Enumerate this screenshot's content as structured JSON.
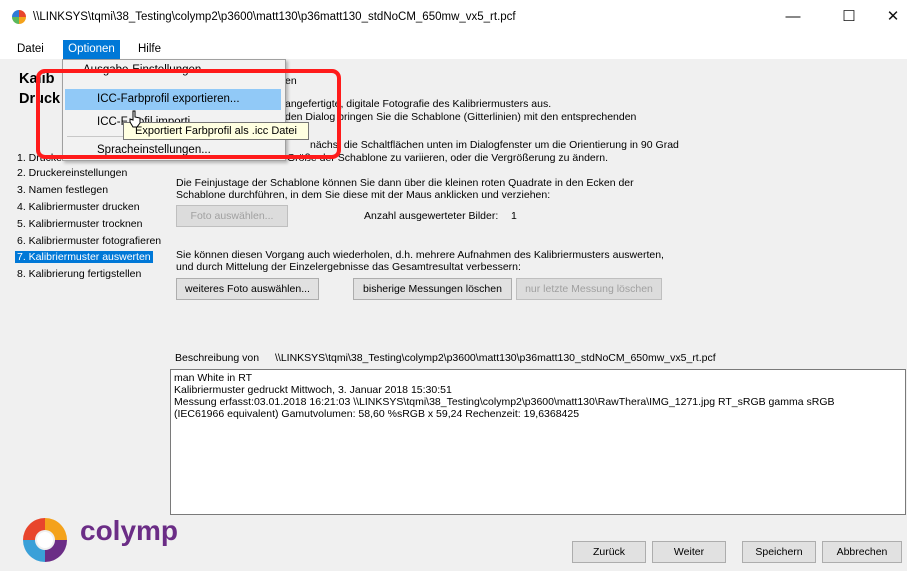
{
  "window": {
    "title": "\\\\LINKSYS\\tqmi\\38_Testing\\colymp2\\p3600\\matt130\\p36matt130_stdNoCM_650mw_vx5_rt.pcf",
    "minimize": "—",
    "maximize": "☐",
    "close": "✕"
  },
  "menu": {
    "datei": "Datei",
    "optionen": "Optionen",
    "hilfe": "Hilfe"
  },
  "dropdown": {
    "items": [
      "Ausgabe-Einstellungen...",
      "ICC-Farbprofil exportieren...",
      "ICC-Farbprofil importieren...",
      "Spracheinstellungen..."
    ],
    "visible_fragments": {
      "item3": "ICC-F",
      "item3_tail": "rofil importi",
      "item4": "Spracheinstellungen..."
    },
    "tooltip": "Exportiert Farbprofil als .icc Datei"
  },
  "heading": {
    "line1": "Kalib",
    "line2": "Druck",
    "line1_tail": "en"
  },
  "steps": [
    "1. Drucke",
    "2. Druckereinstellungen",
    "3. Namen festlegen",
    "4. Kalibriermuster drucken",
    "5. Kalibriermuster trocknen",
    "6. Kalibriermuster fotografieren",
    "7. Kalibriermuster auswerten",
    "8. Kalibrierung fertigstellen"
  ],
  "active_step": 7,
  "instructions": {
    "p1_l1": "angefertigte, digitale Fotografie des Kalibriermusters aus.",
    "p1_l2": "den Dialog bringen Sie die Schablone (Gitterlinien) mit den entsprechenden",
    "p2_l1": "nächst die Schaltflächen unten im Dialogfenster um die Orientierung in 90 Grad",
    "p2_l2": "Größe der Schablone zu variieren, oder die Vergrößerung zu ändern.",
    "p3_l1": "Die Feinjustage der Schablone können Sie dann über die kleinen roten Quadrate in den Ecken der",
    "p3_l2": "Schablone durchführen, in dem Sie diese mit der Maus anklicken und verziehen:",
    "p4_l1": "Sie können diesen Vorgang auch wiederholen, d.h. mehrere Aufnahmen des Kalibriermusters auswerten,",
    "p4_l2": "und durch Mittelung der Einzelergebnisse das Gesamtresultat verbessern:"
  },
  "buttons": {
    "foto_auswaehlen": "Foto auswählen...",
    "weiteres_foto": "weiteres Foto auswählen...",
    "bisherige_loeschen": "bisherige Messungen löschen",
    "letzte_loeschen": "nur letzte Messung löschen",
    "zurueck": "Zurück",
    "weiter": "Weiter",
    "speichern": "Speichern",
    "abbrechen": "Abbrechen"
  },
  "count": {
    "label": "Anzahl ausgewerteter Bilder:",
    "value": "1"
  },
  "description": {
    "label": "Beschreibung von",
    "path": "\\\\LINKSYS\\tqmi\\38_Testing\\colymp2\\p3600\\matt130\\p36matt130_stdNoCM_650mw_vx5_rt.pcf",
    "lines": [
      "man White in RT",
      "Kalibriermuster gedruckt Mittwoch, 3. Januar 2018 15:30:51",
      "Messung erfasst:03.01.2018 16:21:03 \\\\LINKSYS\\tqmi\\38_Testing\\colymp2\\p3600\\matt130\\RawThera\\IMG_1271.jpg RT_sRGB gamma sRGB",
      "(IEC61966 equivalent) Gamutvolumen: 58,60 %sRGB x 59,24 Rechenzeit: 19,6368425"
    ]
  },
  "logo": {
    "text": "colymp"
  },
  "colors": {
    "accent": "#0078d7",
    "highlight_box": "#ff1b1b",
    "logo_text": "#6b2d86"
  }
}
